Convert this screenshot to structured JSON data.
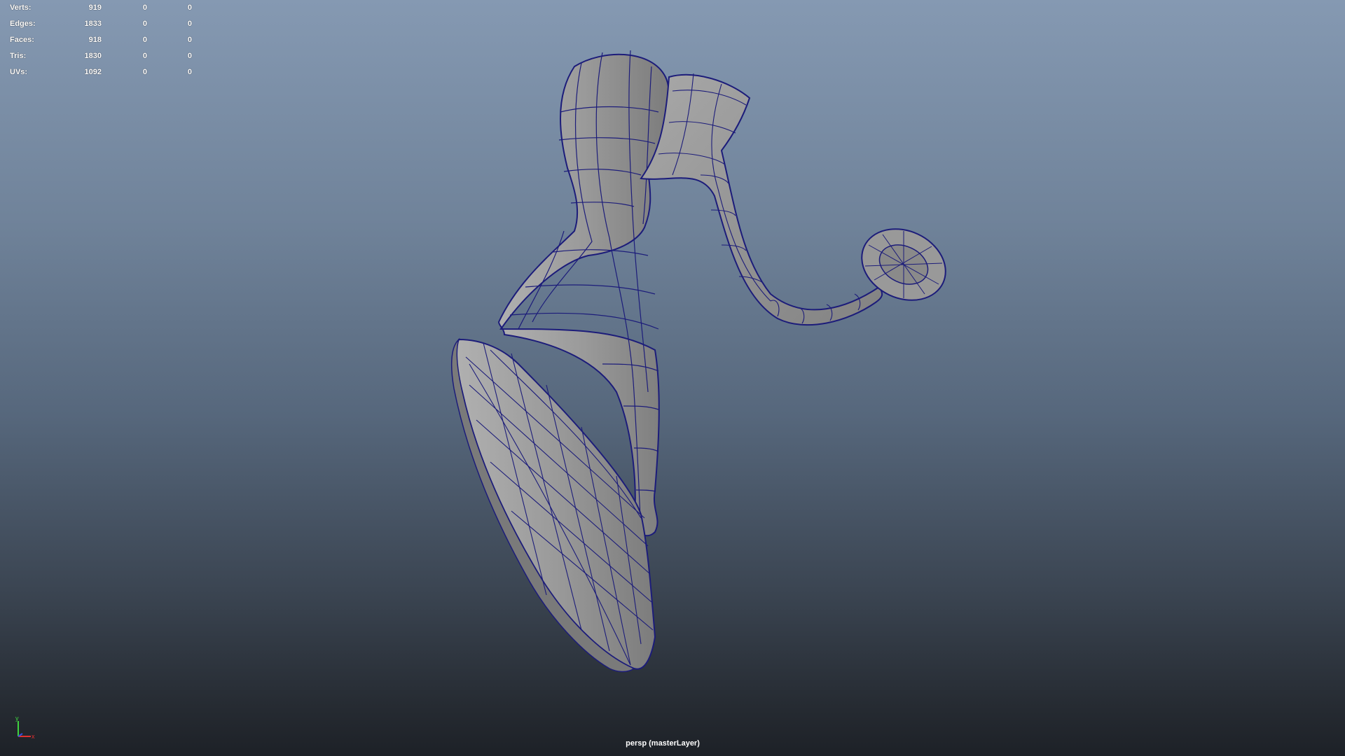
{
  "hud": {
    "stats": [
      {
        "label": "Verts:",
        "v1": "919",
        "v2": "0",
        "v3": "0"
      },
      {
        "label": "Edges:",
        "v1": "1833",
        "v2": "0",
        "v3": "0"
      },
      {
        "label": "Faces:",
        "v1": "918",
        "v2": "0",
        "v3": "0"
      },
      {
        "label": "Tris:",
        "v1": "1830",
        "v2": "0",
        "v3": "0"
      },
      {
        "label": "UVs:",
        "v1": "1092",
        "v2": "0",
        "v3": "0"
      }
    ]
  },
  "viewport": {
    "camera_label": "persp (masterLayer)",
    "axis_labels": {
      "y": "y",
      "x": "x"
    },
    "colors": {
      "mesh_fill": "#9c9c9c",
      "wire": "#1c1c7a",
      "bg_top": "#8599b2",
      "bg_bottom": "#1d2127"
    }
  }
}
